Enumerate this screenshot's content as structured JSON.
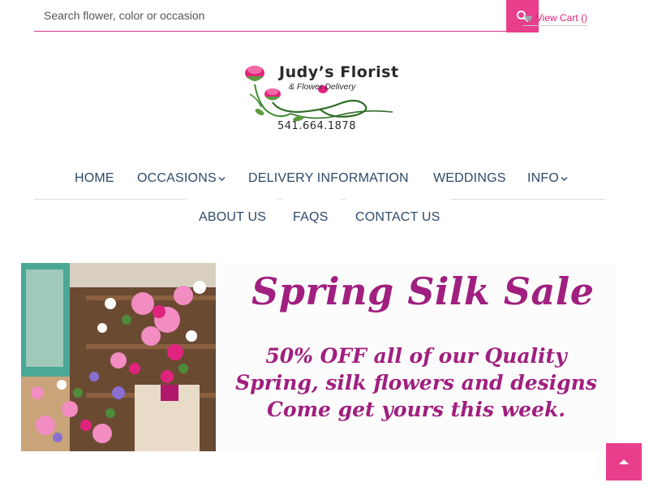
{
  "search": {
    "placeholder": "Search flower, color or occasion"
  },
  "cart": {
    "label": "View Cart ()"
  },
  "logo": {
    "title": "Judy’s Florist",
    "subtitle": "& Flower Delivery",
    "phone": "541.664.1878"
  },
  "nav": {
    "home": "HOME",
    "occasions": "OCCASIONS",
    "delivery": "DELIVERY INFORMATION",
    "weddings": "WEDDINGS",
    "info": "INFO",
    "about": "ABOUT US",
    "faqs": "FAQS",
    "contact": "CONTACT US"
  },
  "banner": {
    "title": "Spring Silk Sale",
    "line1": "50% OFF all of our Quality",
    "line2": "Spring, silk flowers and designs",
    "line3": "Come get yours this week."
  },
  "colors": {
    "accent": "#e83e8c",
    "nav_text": "#2d4a6a",
    "banner_text": "#a01f7f"
  },
  "icons": {
    "search": "search-icon",
    "cart": "cart-icon",
    "chevron": "chevron-down-icon",
    "back_to_top": "chevron-up-icon"
  }
}
